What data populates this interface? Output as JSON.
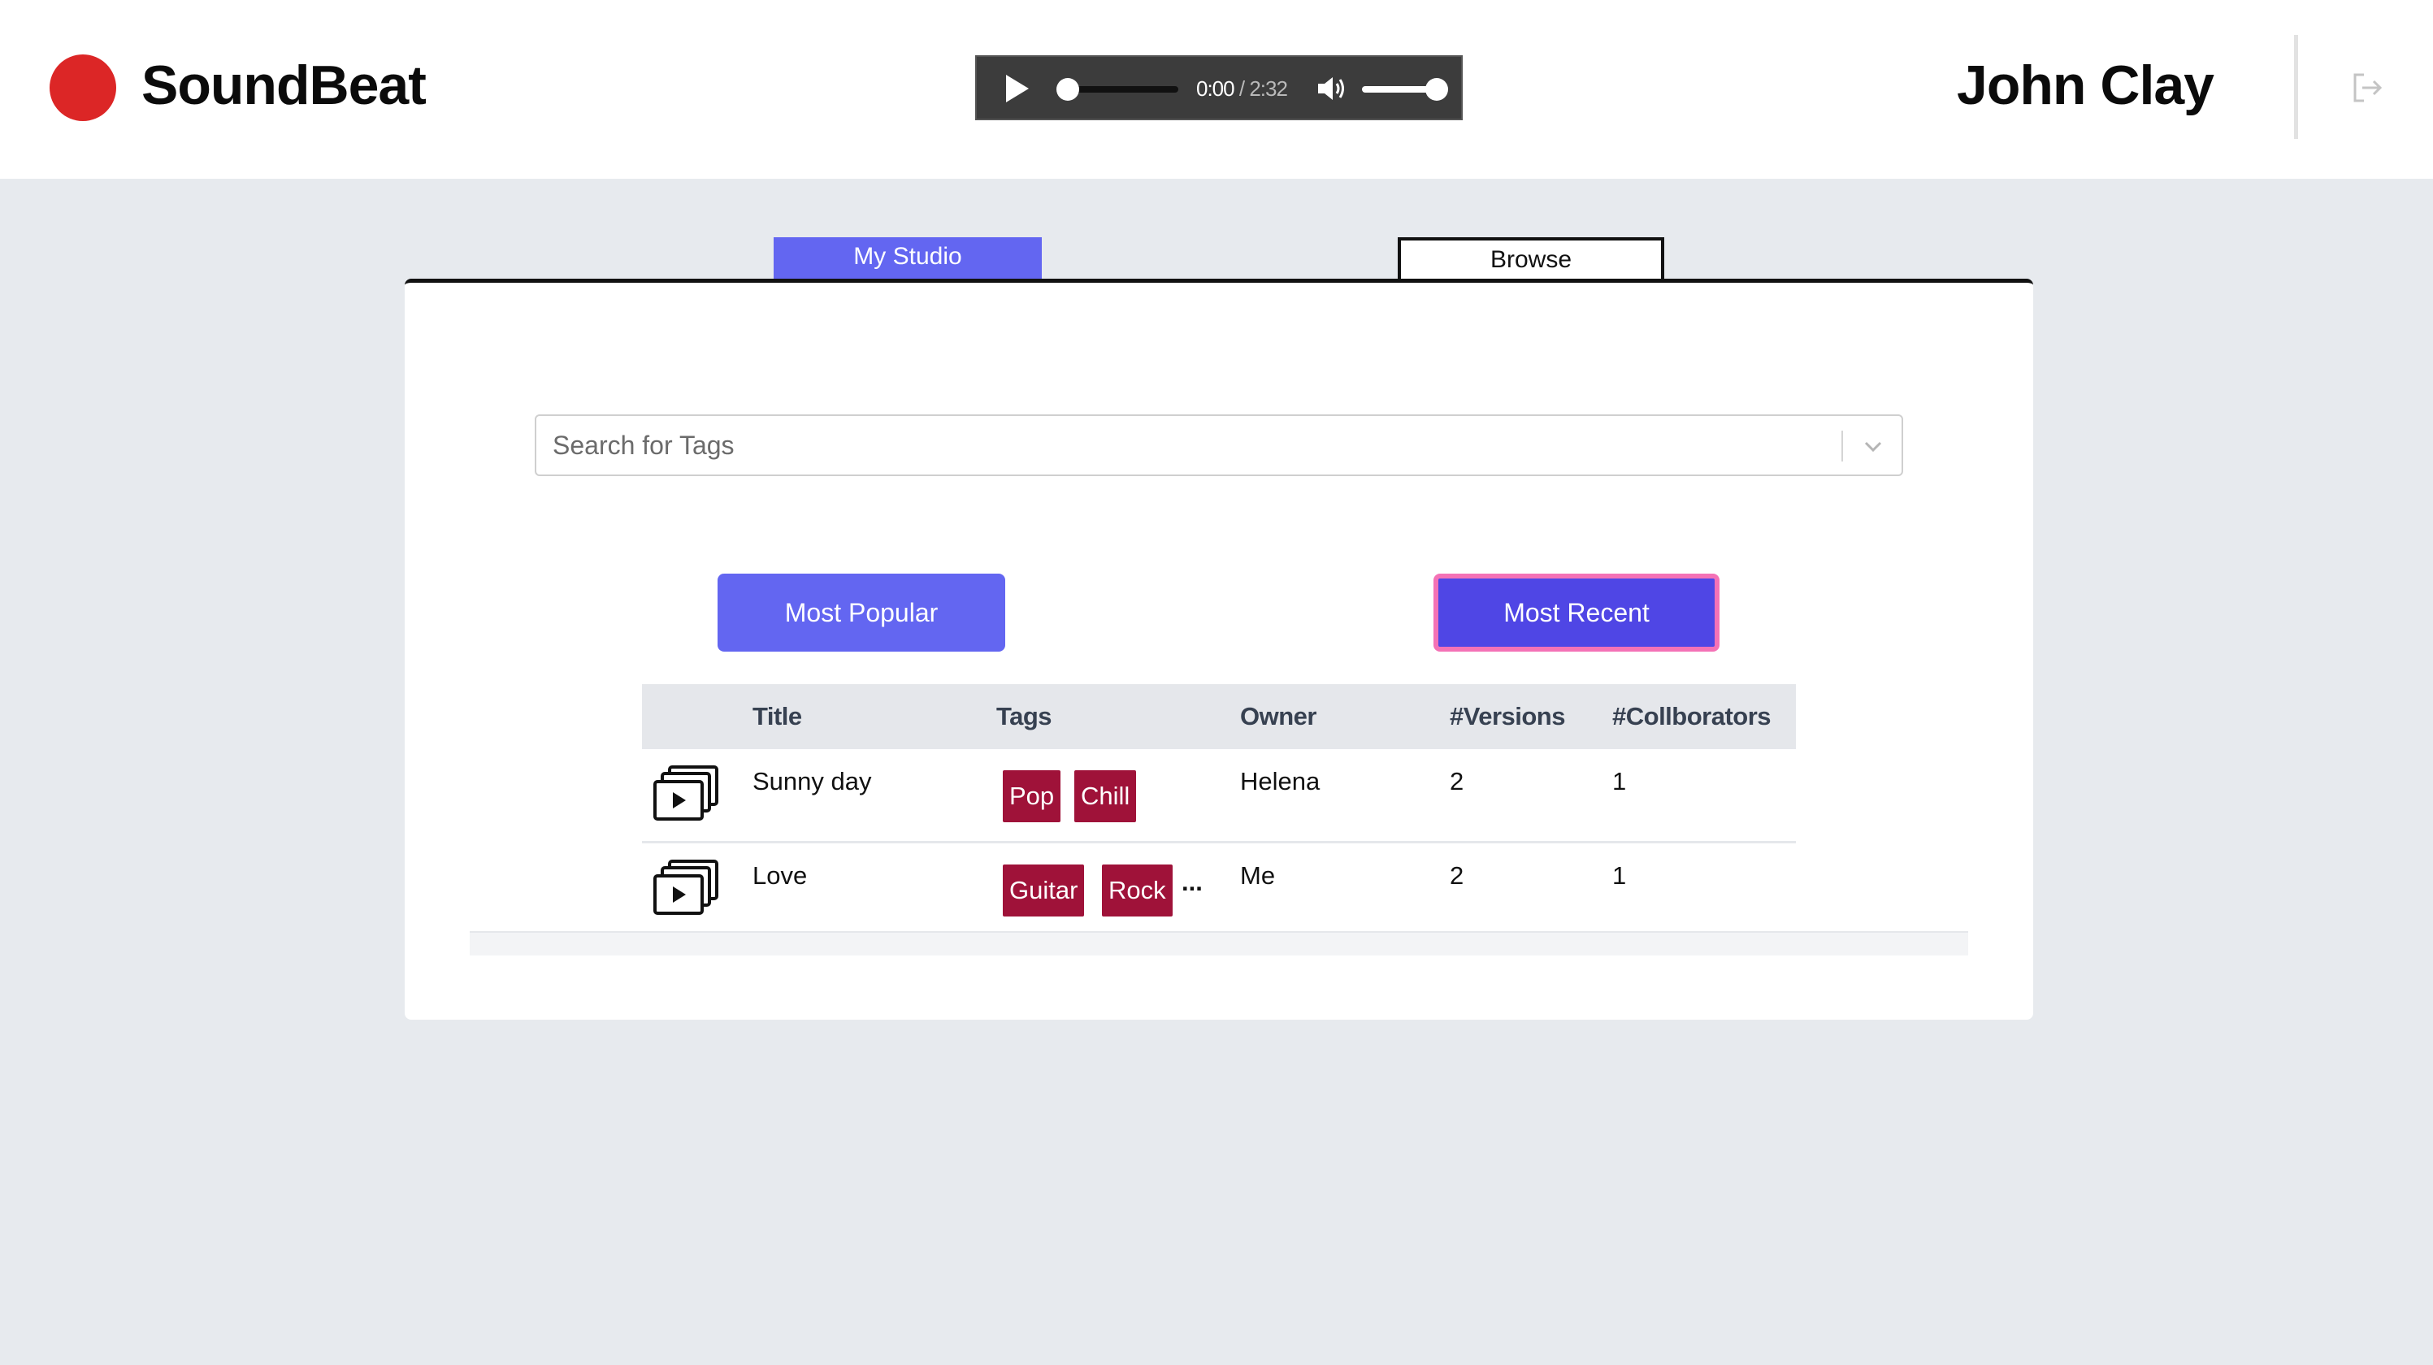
{
  "app": {
    "brand": "SoundBeat",
    "user_name": "John Clay"
  },
  "player": {
    "current_time": "0:00",
    "separator": "/",
    "duration": "2:32",
    "progress": 0.0,
    "volume": 0.85
  },
  "tabs": {
    "studio": "My Studio",
    "browse": "Browse",
    "active": "studio"
  },
  "search": {
    "placeholder": "Search for Tags"
  },
  "sort_buttons": {
    "popular": "Most Popular",
    "recent": "Most Recent",
    "active": "recent"
  },
  "table": {
    "headers": {
      "title": "Title",
      "tags": "Tags",
      "owner": "Owner",
      "versions": "#Versions",
      "collaborators": "#Collborators"
    },
    "rows": [
      {
        "title": "Sunny day",
        "tags": [
          "Pop",
          "Chill"
        ],
        "more": "",
        "owner": "Helena",
        "versions": "2",
        "collaborators": "1"
      },
      {
        "title": "Love",
        "tags": [
          "Guitar",
          "Rock"
        ],
        "more": "...",
        "owner": "Me",
        "versions": "2",
        "collaborators": "1"
      }
    ]
  },
  "colors": {
    "brand_dot": "#dc2626",
    "primary": "#6366f1",
    "primary_dark": "#4f46e5",
    "focus_ring": "#f472b6",
    "tag": "#9f1239"
  },
  "icons": {
    "play": "play-icon",
    "volume": "volume-icon",
    "logout": "logout-icon",
    "chevron": "chevron-down-icon",
    "track": "video-stack-icon"
  }
}
